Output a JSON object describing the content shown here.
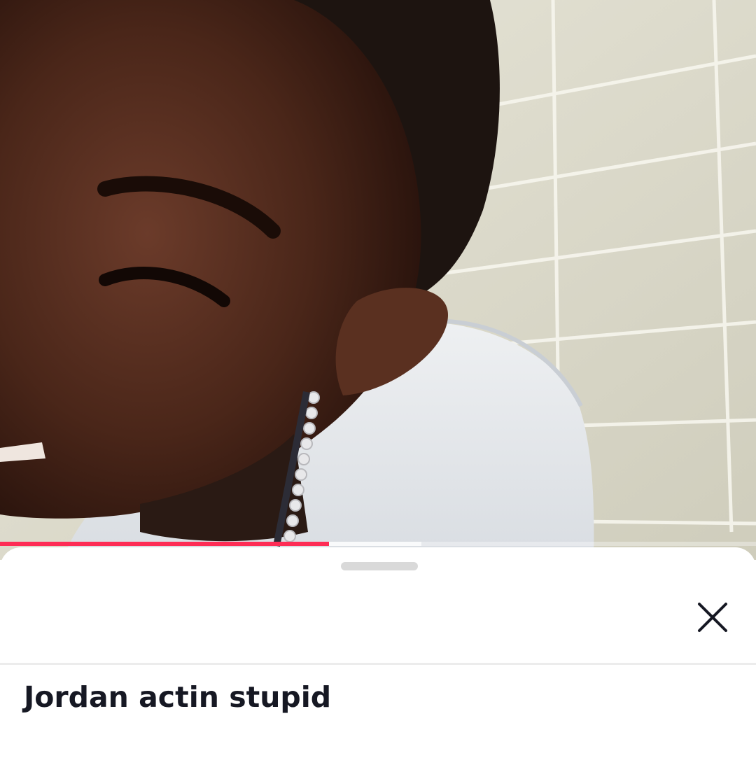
{
  "video": {
    "progress_fraction": 0.435,
    "buffered_fraction": 0.557,
    "progress_color": "#fe2c55"
  },
  "sheet": {
    "drag_handle_icon": "drag-handle",
    "close_icon": "close-x-icon",
    "caption": "Jordan actin stupid"
  }
}
